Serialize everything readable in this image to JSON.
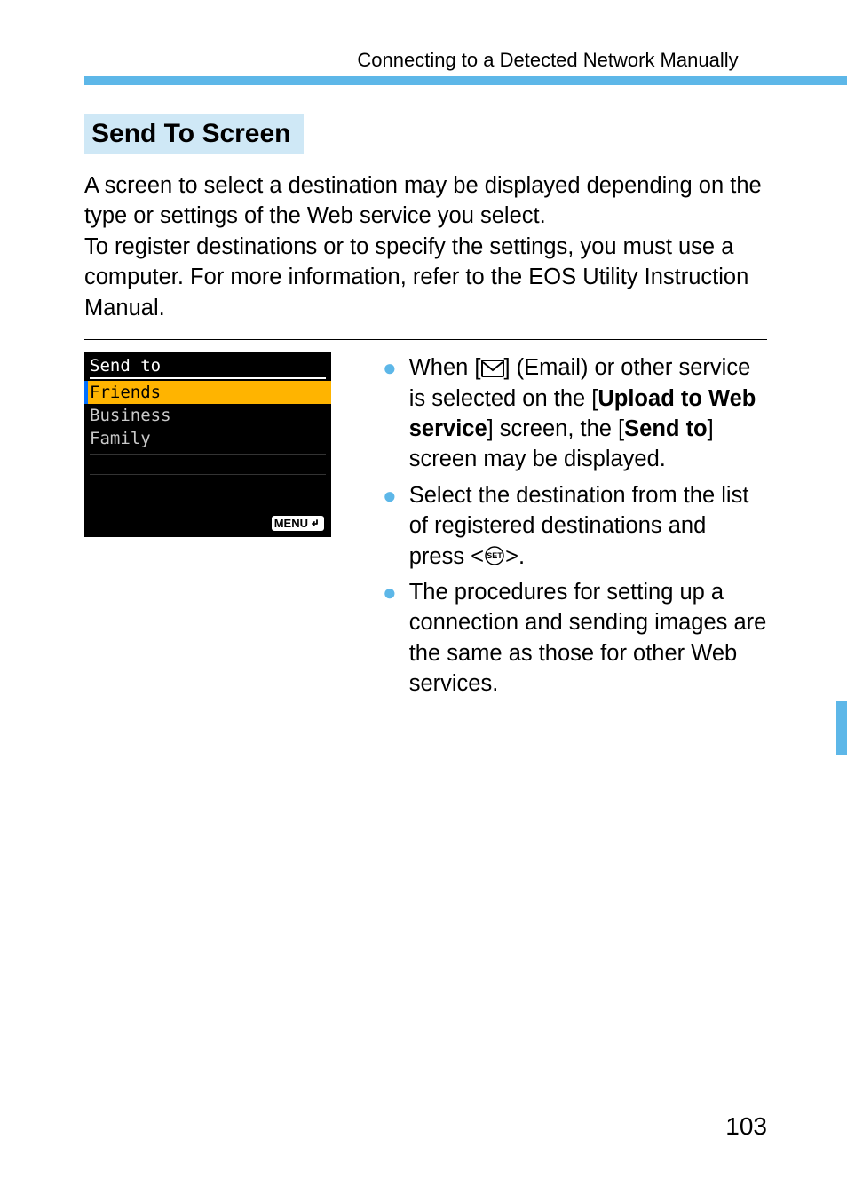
{
  "header": "Connecting to a Detected Network Manually",
  "heading": "Send To Screen",
  "intro": "A screen to select a destination may be displayed depending on the type or settings of the Web service you select.\nTo register destinations or to specify the settings, you must use a computer. For more information, refer to the EOS Utility Instruction Manual.",
  "screenshot": {
    "title": "Send to",
    "items": [
      "Friends",
      "Business",
      "Family"
    ],
    "selected_index": 0,
    "menu_label": "MENU"
  },
  "bullets": {
    "b1_pre": "When [",
    "b1_mid": "] (Email) or other service is selected on the [",
    "b1_bold1": "Upload to Web service",
    "b1_mid2": "] screen, the [",
    "b1_bold2": "Send to",
    "b1_post": "] screen may be displayed.",
    "b2_pre": "Select the destination from the list of registered destinations and press <",
    "b2_post": ">.",
    "b3": "The procedures for setting up a connection and sending images are the same as those for other Web services."
  },
  "page_number": "103"
}
